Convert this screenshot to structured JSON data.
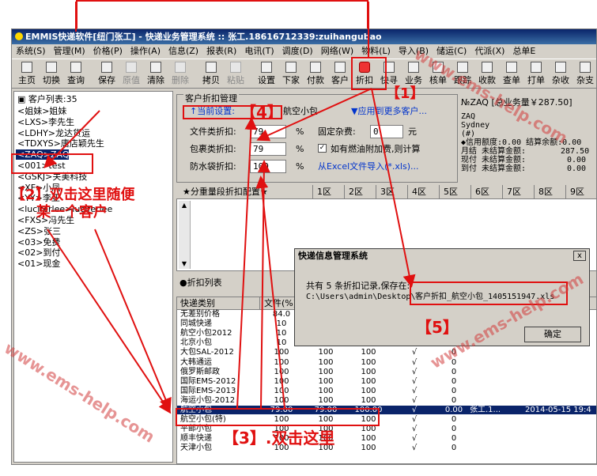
{
  "window": {
    "title": "EMMIS快递软件[纽门张工] - 快递业务管理系统 :: 张工.18616712339:zuihangubao"
  },
  "menu": [
    "系统(S)",
    "管理(M)",
    "价格(P)",
    "操作(A)",
    "信息(Z)",
    "报表(R)",
    "电讯(T)",
    "调度(D)",
    "网络(W)",
    "物料(L)",
    "导入(B)",
    "储运(C)",
    "代派(X)",
    "总单E"
  ],
  "toolbar": [
    {
      "label": "主页",
      "icon": "home-icon",
      "enabled": true
    },
    {
      "label": "切换",
      "icon": "switch-icon",
      "enabled": true
    },
    {
      "label": "查询",
      "icon": "search-icon",
      "enabled": true
    },
    {
      "label": "保存",
      "icon": "save-icon",
      "enabled": true
    },
    {
      "label": "原值",
      "icon": "undo-icon",
      "enabled": false
    },
    {
      "label": "清除",
      "icon": "clear-icon",
      "enabled": true
    },
    {
      "label": "删除",
      "icon": "delete-icon",
      "enabled": false
    },
    {
      "label": "拷贝",
      "icon": "copy-icon",
      "enabled": true
    },
    {
      "label": "粘贴",
      "icon": "paste-icon",
      "enabled": false
    },
    {
      "label": "设置",
      "icon": "settings-icon",
      "enabled": true
    },
    {
      "label": "下家",
      "icon": "next-icon",
      "enabled": true
    },
    {
      "label": "付款",
      "icon": "payment-icon",
      "enabled": true
    },
    {
      "label": "客户",
      "icon": "customer-icon",
      "enabled": true
    },
    {
      "label": "折扣",
      "icon": "discount-icon",
      "enabled": true
    },
    {
      "label": "快寻",
      "icon": "quick-search-icon",
      "enabled": true
    },
    {
      "label": "业务",
      "icon": "business-icon",
      "enabled": true
    },
    {
      "label": "核单",
      "icon": "verify-icon",
      "enabled": true
    },
    {
      "label": "跟踪",
      "icon": "track-icon",
      "enabled": true
    },
    {
      "label": "收款",
      "icon": "receive-icon",
      "enabled": true
    },
    {
      "label": "查单",
      "icon": "lookup-icon",
      "enabled": true
    },
    {
      "label": "打单",
      "icon": "print-icon",
      "enabled": true
    },
    {
      "label": "杂收",
      "icon": "misc-income-icon",
      "enabled": true
    },
    {
      "label": "杂支",
      "icon": "misc-expense-icon",
      "enabled": true
    }
  ],
  "customer_list": {
    "title": "客户列表:35",
    "items": [
      "<姐妹>姐妹",
      "<LXS>李先生",
      "<LDHY>龙达货运",
      "<TDXYS>唐店颖先生",
      "<ZAQ>ZAQ",
      "<001>test",
      "<GSKJ>关美科技",
      "<XF>小凤",
      "<YY>李亚",
      "<luciferlee>luciferlee",
      "<FXS>冯先生",
      "<ZS>张三",
      "<03>免费",
      "<02>到付",
      "<01>现金"
    ],
    "selected_index": 4
  },
  "discount_panel": {
    "group_title": "客户折扣管理",
    "current_setting_label": "↑当前设置:",
    "current_setting_value": "航空小包",
    "apply_more_link": "▼应用到更多客户...",
    "file_label": "文件类折扣:",
    "file_value": "79",
    "package_label": "包裹类折扣:",
    "package_value": "79",
    "waterproof_label": "防水袋折扣:",
    "waterproof_value": "100",
    "percent": "%",
    "fixed_fee_label": "固定杂费:",
    "fixed_fee_value": "0",
    "yuan": "元",
    "fuel_checkbox_label": "如有燃油附加费,则计算",
    "fuel_checked": true,
    "import_link": "从Excel文件导入(*.xls)..."
  },
  "account": {
    "header": "№ZAQ [总业务量￥287.50]",
    "code": "ZAQ",
    "city": "Sydney",
    "hash": "(#)",
    "credit_line": "◆信用额度:0.00 结算余额:0.00",
    "month_label": "月结 未结算金额:",
    "month_value": "287.50",
    "cash_label": "现付 未结算金额:",
    "cash_value": "0.00",
    "cod_label": "到付 未结算金额:",
    "cod_value": "0.00"
  },
  "zone_tabs": {
    "title": "★分重量段折扣配置★",
    "zones": [
      "1区",
      "2区",
      "3区",
      "4区",
      "5区",
      "6区",
      "7区",
      "8区",
      "9区"
    ]
  },
  "discount_list": {
    "title": "●折扣列表",
    "columns": [
      "快递类别",
      "文件(%)"
    ],
    "rows": [
      [
        "无差别价格",
        "84.0",
        "",
        "",
        ""
      ],
      [
        "同城快递",
        "10",
        "",
        "",
        ""
      ],
      [
        "航空小包2012",
        "10",
        "",
        "",
        ""
      ],
      [
        "北京小包",
        "10",
        "",
        "",
        ""
      ],
      [
        "大包SAL-2012",
        "100",
        "100",
        "100",
        "√",
        "0"
      ],
      [
        "大韩通运",
        "100",
        "100",
        "100",
        "√",
        "0"
      ],
      [
        "俄罗斯邮政",
        "100",
        "100",
        "100",
        "√",
        "0"
      ],
      [
        "国际EMS-2012",
        "100",
        "100",
        "100",
        "√",
        "0"
      ],
      [
        "国际EMS-2013",
        "100",
        "100",
        "100",
        "√",
        "0"
      ],
      [
        "海运小包-2012",
        "100",
        "100",
        "100",
        "√",
        "0"
      ],
      [
        "航空小包",
        "79.00",
        "79.00",
        "100.00",
        "√",
        "0.00",
        "张工.1...",
        "2014-05-15 19:4"
      ],
      [
        "航空小包(特)",
        "100",
        "100",
        "100",
        "√",
        "0"
      ],
      [
        "平邮小包",
        "100",
        "100",
        "100",
        "√",
        "0"
      ],
      [
        "顺丰快递",
        "100",
        "100",
        "100",
        "√",
        "0"
      ],
      [
        "天津小包",
        "100",
        "100",
        "100",
        "√",
        "0"
      ]
    ],
    "highlight_index": 10
  },
  "dialog": {
    "title": "快递信息管理系统",
    "message": "共有 5 条折扣记录,保存在:",
    "path_prefix": "C:\\Users\\admin\\Desktop\\",
    "path_file": "客户折扣_航空小包_1405151947.xls",
    "ok_label": "确定",
    "close_label": "x"
  },
  "annotations": {
    "step1": "【1】",
    "step2a": "【2】双击这里随便",
    "step2b": "某一个客户",
    "step3": "【3】.双击这里",
    "step4": "【4】",
    "step5": "【5】",
    "red_color": "#e01010"
  },
  "watermark": "www.ems-help.com"
}
